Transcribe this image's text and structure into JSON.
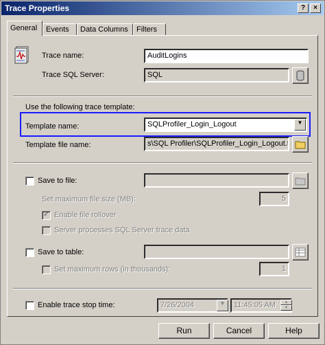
{
  "window": {
    "title": "Trace Properties",
    "help_btn": "?",
    "close_btn": "×"
  },
  "tabs": [
    {
      "label": "General"
    },
    {
      "label": "Events"
    },
    {
      "label": "Data Columns"
    },
    {
      "label": "Filters"
    }
  ],
  "general": {
    "trace_name_label": "Trace name:",
    "trace_name_value": "AuditLogins",
    "trace_server_label": "Trace SQL Server:",
    "trace_server_value": "SQL",
    "template_section_label": "Use the following trace template:",
    "template_name_label": "Template name:",
    "template_name_value": "SQLProfiler_Login_Logout",
    "template_file_label": "Template file name:",
    "template_file_value": "s\\SQL Profiler\\SQLProfiler_Login_Logout.tdf",
    "save_to_file_label": "Save to file:",
    "max_file_size_label": "Set maximum file size (MB):",
    "max_file_size_value": "5",
    "enable_rollover_label": "Enable file rollover",
    "server_processes_label": "Server processes SQL Server trace data",
    "save_to_table_label": "Save to table:",
    "max_rows_label": "Set maximum rows (in thousands):",
    "max_rows_value": "1",
    "stop_time_label": "Enable trace stop time:",
    "stop_date_value": "7/26/2004",
    "stop_time_value": "11:45:05 AM"
  },
  "buttons": {
    "run": "Run",
    "cancel": "Cancel",
    "help": "Help"
  },
  "colors": {
    "highlight": "#1a1aff",
    "titlebar_start": "#0a246a"
  }
}
